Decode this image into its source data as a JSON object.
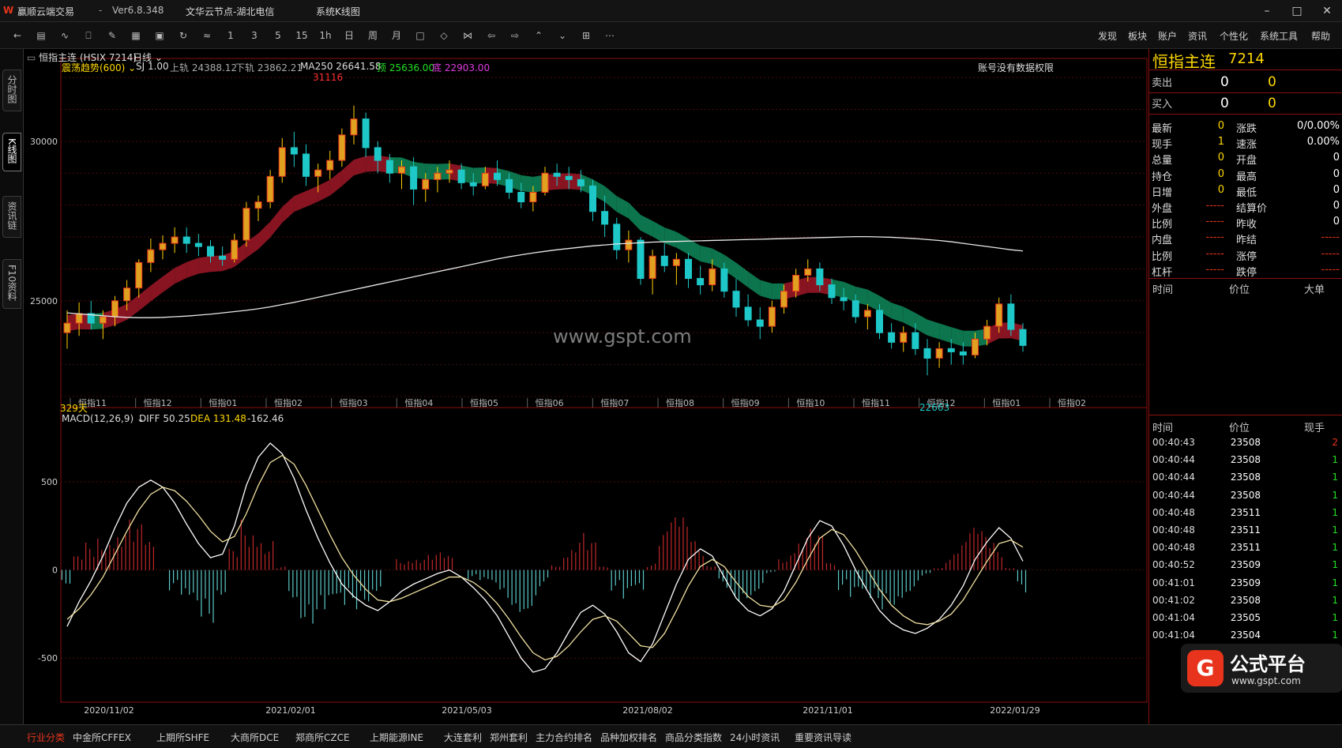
{
  "window": {
    "app_title": "赢顺云端交易",
    "version": "Ver6.8.348",
    "server": "文华云节点-湖北电信",
    "menu_label": "系统K线图"
  },
  "toolbar": {
    "period_buttons": [
      "1",
      "3",
      "5",
      "15",
      "1h",
      "日",
      "周",
      "月"
    ],
    "right_menu": [
      "发现",
      "板块",
      "账户",
      "资讯",
      "个性化",
      "系统工具",
      "帮助"
    ]
  },
  "left_tabs": [
    "分时图",
    "K线图",
    "资讯链",
    "F10资料"
  ],
  "chart_header": {
    "instrument": "恒指主连 (HSIX 7214)",
    "period": "日线",
    "indicator": "震荡趋势(600)",
    "sj": "SJ 1.00",
    "upper": "上轨 24388.12",
    "lower": "下轨 23862.21",
    "ma": "MA250 26641.58",
    "top": "顶 25636.00",
    "bottom": "底 22903.00",
    "account_note": "账号没有数据权限"
  },
  "chart_data": {
    "type": "candlestick",
    "ylim": [
      21900,
      32200
    ],
    "yticks": [
      25000,
      30000
    ],
    "xlabels": [
      "恒指11",
      "恒指12",
      "恒指01",
      "恒指02",
      "恒指03",
      "恒指04",
      "恒指05",
      "恒指06",
      "恒指07",
      "恒指08",
      "恒指09",
      "恒指10",
      "恒指11",
      "恒指12",
      "恒指01",
      "恒指02"
    ],
    "max_label": "31116",
    "min_label": "22663",
    "days_label": "329天",
    "bars": [
      [
        24000,
        24700,
        23500,
        24300
      ],
      [
        24300,
        24950,
        23900,
        24600
      ],
      [
        24600,
        25000,
        24100,
        24300
      ],
      [
        24300,
        24700,
        23800,
        24500
      ],
      [
        24500,
        25150,
        24200,
        25000
      ],
      [
        25000,
        25650,
        24700,
        25400
      ],
      [
        25400,
        26300,
        25100,
        26200
      ],
      [
        26200,
        26950,
        25900,
        26600
      ],
      [
        26600,
        27050,
        26300,
        26800
      ],
      [
        26800,
        27300,
        26500,
        27000
      ],
      [
        27000,
        27300,
        26500,
        26800
      ],
      [
        26800,
        27100,
        26400,
        26700
      ],
      [
        26700,
        26900,
        26200,
        26400
      ],
      [
        26400,
        26700,
        26100,
        26300
      ],
      [
        26300,
        27100,
        26200,
        26900
      ],
      [
        26900,
        28100,
        26700,
        27900
      ],
      [
        27900,
        28300,
        27500,
        28100
      ],
      [
        28100,
        29100,
        27900,
        28900
      ],
      [
        28900,
        30100,
        28700,
        29800
      ],
      [
        29800,
        30300,
        29200,
        29600
      ],
      [
        29600,
        29900,
        28600,
        28900
      ],
      [
        28900,
        29300,
        28400,
        29100
      ],
      [
        29100,
        29700,
        28800,
        29400
      ],
      [
        29400,
        30400,
        29200,
        30200
      ],
      [
        30200,
        31116,
        29900,
        30700
      ],
      [
        30700,
        30900,
        29500,
        29800
      ],
      [
        29800,
        30000,
        29000,
        29400
      ],
      [
        29400,
        29600,
        28700,
        29000
      ],
      [
        29000,
        29400,
        28500,
        29200
      ],
      [
        29200,
        29500,
        28000,
        28500
      ],
      [
        28500,
        29000,
        28100,
        28800
      ],
      [
        28800,
        29200,
        28400,
        29000
      ],
      [
        29000,
        29400,
        28700,
        29100
      ],
      [
        29100,
        29300,
        28500,
        28700
      ],
      [
        28700,
        29000,
        28300,
        28600
      ],
      [
        28600,
        29200,
        28500,
        29000
      ],
      [
        29000,
        29400,
        28600,
        28800
      ],
      [
        28800,
        29000,
        28200,
        28400
      ],
      [
        28400,
        28700,
        27900,
        28100
      ],
      [
        28100,
        28600,
        27800,
        28400
      ],
      [
        28400,
        29200,
        28300,
        29000
      ],
      [
        29000,
        29300,
        28600,
        28900
      ],
      [
        28900,
        29200,
        28500,
        28800
      ],
      [
        28800,
        29100,
        28400,
        28600
      ],
      [
        28600,
        28800,
        27500,
        27800
      ],
      [
        27800,
        28300,
        27000,
        27400
      ],
      [
        27400,
        27600,
        26300,
        26600
      ],
      [
        26600,
        27200,
        26200,
        26900
      ],
      [
        26900,
        27000,
        25500,
        25700
      ],
      [
        25700,
        26600,
        25200,
        26400
      ],
      [
        26400,
        26800,
        25900,
        26100
      ],
      [
        26100,
        26500,
        25500,
        26300
      ],
      [
        26300,
        26500,
        25400,
        25700
      ],
      [
        25700,
        26100,
        25200,
        25500
      ],
      [
        25500,
        26300,
        25300,
        26000
      ],
      [
        26000,
        26200,
        25100,
        25300
      ],
      [
        25300,
        25700,
        24500,
        24800
      ],
      [
        24800,
        25200,
        24200,
        24400
      ],
      [
        24400,
        24800,
        23800,
        24200
      ],
      [
        24200,
        25000,
        24000,
        24800
      ],
      [
        24800,
        25500,
        24600,
        25300
      ],
      [
        25300,
        26000,
        25100,
        25800
      ],
      [
        25800,
        26300,
        25600,
        26000
      ],
      [
        26000,
        26200,
        25300,
        25500
      ],
      [
        25500,
        25700,
        24900,
        25100
      ],
      [
        25100,
        25400,
        24700,
        25000
      ],
      [
        25000,
        25200,
        24300,
        24500
      ],
      [
        24500,
        24900,
        24100,
        24700
      ],
      [
        24700,
        24900,
        23800,
        24000
      ],
      [
        24000,
        24300,
        23500,
        23700
      ],
      [
        23700,
        24200,
        23400,
        24000
      ],
      [
        24000,
        24300,
        23300,
        23500
      ],
      [
        23500,
        23800,
        22663,
        23200
      ],
      [
        23200,
        23700,
        22900,
        23500
      ],
      [
        23500,
        23800,
        23000,
        23400
      ],
      [
        23400,
        23700,
        23000,
        23300
      ],
      [
        23300,
        24000,
        23200,
        23800
      ],
      [
        23800,
        24400,
        23600,
        24200
      ],
      [
        24200,
        25100,
        24000,
        24900
      ],
      [
        24900,
        25200,
        23900,
        24100
      ],
      [
        24100,
        24300,
        23400,
        23600
      ]
    ],
    "ma250": [
      24620,
      24590,
      24560,
      24530,
      24500,
      24480,
      24470,
      24470,
      24480,
      24500,
      24520,
      24550,
      24580,
      24620,
      24660,
      24700,
      24750,
      24810,
      24880,
      24950,
      25030,
      25110,
      25190,
      25270,
      25350,
      25430,
      25510,
      25590,
      25670,
      25750,
      25830,
      25910,
      25990,
      26070,
      26150,
      26230,
      26310,
      26380,
      26440,
      26500,
      26550,
      26600,
      26640,
      26680,
      26720,
      26750,
      26780,
      26800,
      26820,
      26840,
      26850,
      26860,
      26870,
      26880,
      26890,
      26900,
      26910,
      26920,
      26930,
      26940,
      26950,
      26960,
      26970,
      26980,
      26990,
      27000,
      27010,
      27010,
      27000,
      26990,
      26970,
      26950,
      26920,
      26890,
      26850,
      26800,
      26750,
      26700,
      26650,
      26600,
      26560
    ],
    "macd_ylim": [
      -750,
      850
    ],
    "macd_yticks": [
      500,
      0,
      -500
    ],
    "macd_header": {
      "name": "MACD(12,26,9)",
      "diff": "DIFF 50.25",
      "dea": "DEA 131.48",
      "macd": "-162.46"
    },
    "date_labels": [
      "2020/11/02",
      "2021/02/01",
      "2021/05/03",
      "2021/08/02",
      "2021/11/01",
      "2022/01/29"
    ],
    "diff": [
      -320,
      -180,
      -60,
      80,
      240,
      380,
      470,
      510,
      470,
      380,
      260,
      150,
      70,
      90,
      250,
      480,
      640,
      720,
      660,
      520,
      340,
      180,
      40,
      -80,
      -150,
      -200,
      -230,
      -180,
      -120,
      -80,
      -50,
      -20,
      0,
      -40,
      -100,
      -170,
      -260,
      -380,
      -500,
      -580,
      -560,
      -470,
      -350,
      -240,
      -200,
      -250,
      -350,
      -470,
      -520,
      -420,
      -250,
      -80,
      60,
      120,
      80,
      -40,
      -160,
      -230,
      -260,
      -220,
      -120,
      30,
      180,
      280,
      250,
      140,
      0,
      -120,
      -230,
      -300,
      -340,
      -360,
      -330,
      -280,
      -200,
      -90,
      60,
      160,
      240,
      180,
      50
    ],
    "dea": [
      -280,
      -220,
      -140,
      -40,
      90,
      220,
      340,
      430,
      470,
      450,
      390,
      310,
      220,
      160,
      190,
      320,
      480,
      610,
      650,
      600,
      480,
      340,
      200,
      70,
      -30,
      -110,
      -170,
      -180,
      -160,
      -130,
      -100,
      -70,
      -40,
      -40,
      -70,
      -120,
      -190,
      -280,
      -380,
      -470,
      -510,
      -490,
      -430,
      -350,
      -280,
      -260,
      -290,
      -360,
      -430,
      -440,
      -360,
      -230,
      -90,
      20,
      60,
      20,
      -70,
      -150,
      -200,
      -210,
      -170,
      -70,
      60,
      180,
      230,
      200,
      110,
      0,
      -110,
      -200,
      -260,
      -300,
      -310,
      -290,
      -250,
      -170,
      -60,
      50,
      150,
      170,
      130
    ]
  },
  "right_panel": {
    "title": "恒指主连",
    "code": "7214",
    "sell_label": "卖出",
    "sell_price": "0",
    "sell_vol": "0",
    "buy_label": "买入",
    "buy_price": "0",
    "buy_vol": "0",
    "stats": [
      [
        "最新",
        "0",
        "涨跌",
        "0/0.00%"
      ],
      [
        "现手",
        "1",
        "速涨",
        "0.00%"
      ],
      [
        "总量",
        "0",
        "开盘",
        "0"
      ],
      [
        "持仓",
        "0",
        "最高",
        "0"
      ],
      [
        "日增",
        "0",
        "最低",
        "0"
      ],
      [
        "外盘",
        "-----",
        "结算价",
        "0"
      ],
      [
        "比例",
        "-----",
        "昨收",
        "0"
      ],
      [
        "内盘",
        "-----",
        "昨结",
        "-----"
      ],
      [
        "比例",
        "-----",
        "涨停",
        "-----"
      ],
      [
        "杠杆",
        "-----",
        "跌停",
        "-----"
      ]
    ],
    "tab_headers": [
      "时间",
      "价位",
      "大单"
    ],
    "tick_headers": [
      "时间",
      "价位",
      "现手"
    ],
    "ticks": [
      [
        "00:40:43",
        "23508",
        "2"
      ],
      [
        "00:40:44",
        "23508",
        "1"
      ],
      [
        "00:40:44",
        "23508",
        "1"
      ],
      [
        "00:40:44",
        "23508",
        "1"
      ],
      [
        "00:40:48",
        "23511",
        "1"
      ],
      [
        "00:40:48",
        "23511",
        "1"
      ],
      [
        "00:40:48",
        "23511",
        "1"
      ],
      [
        "00:40:52",
        "23509",
        "1"
      ],
      [
        "00:41:01",
        "23509",
        "1"
      ],
      [
        "00:41:02",
        "23508",
        "1"
      ],
      [
        "00:41:04",
        "23505",
        "1"
      ],
      [
        "00:41:04",
        "23504",
        "1"
      ]
    ]
  },
  "bottom_tabs": [
    "行业分类",
    "中金所CFFEX",
    "上期所SHFE",
    "大商所DCE",
    "郑商所CZCE",
    "上期能源INE",
    "大连套利",
    "郑州套利",
    "主力合约排名",
    "品种加权排名",
    "商品分类指数",
    "24小时资讯",
    "重要资讯导读"
  ],
  "watermark": {
    "center": "www.gspt.com",
    "logo_text": "公式平台",
    "logo_url": "www.gspt.com"
  },
  "colors": {
    "up": "#e8341c",
    "down": "#1ec8c8",
    "border": "#8a1010",
    "yellow": "#ffd800"
  }
}
